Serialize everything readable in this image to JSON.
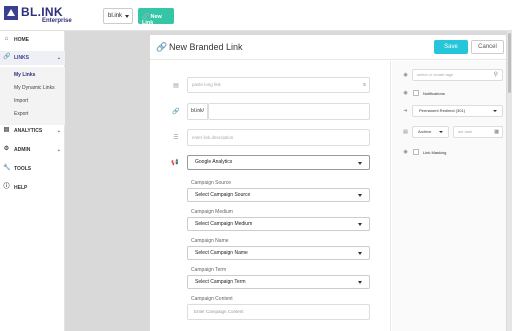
{
  "brand": {
    "name": "BL.INK",
    "sub": "Enterprise"
  },
  "topbar": {
    "domain": "bl.ink",
    "new_link": "New Link"
  },
  "sidebar": {
    "home": "HOME",
    "links": "LINKS",
    "sub": [
      "My Links",
      "My Dynamic Links",
      "Import",
      "Export"
    ],
    "analytics": "ANALYTICS",
    "admin": "ADMIN",
    "tools": "TOOLS",
    "help": "HELP"
  },
  "panel": {
    "title": "New Branded Link",
    "save": "Save",
    "cancel": "Cancel"
  },
  "form": {
    "long_link_placeholder": "paste long link",
    "prefix": "bl.ink/",
    "description_placeholder": "enter link description",
    "integration": "Google Analytics",
    "campaign_source_label": "Campaign Source",
    "campaign_source": "Select Campaign Source",
    "campaign_medium_label": "Campaign Medium",
    "campaign_medium": "Select Campaign Medium",
    "campaign_name_label": "Campaign Name",
    "campaign_name": "Select Campaign Name",
    "campaign_term_label": "Campaign Term",
    "campaign_term": "Select Campaign Term",
    "campaign_content_label": "Campaign Content",
    "campaign_content_placeholder": "Enter Campaign Content"
  },
  "right": {
    "tags_placeholder": "select or create tags",
    "notifications": "Notifications",
    "redirect": "Permanent Redirect (301)",
    "status": "Archive",
    "date_placeholder": "set date",
    "link_masking": "Link Masking"
  },
  "colors": {
    "accent": "#35c7a5",
    "save": "#26c6da",
    "brand": "#2d2f7a"
  }
}
